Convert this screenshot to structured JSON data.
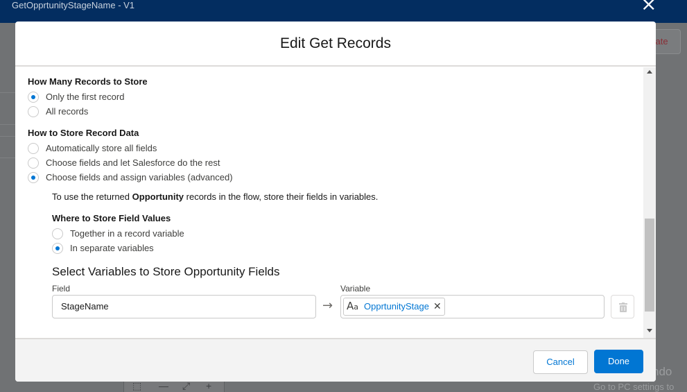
{
  "app": {
    "title": "GetOpprtunityStageName - V1",
    "background_button": "vate"
  },
  "watermark": {
    "line1": "Activate Windo",
    "line2": "Go to PC settings to"
  },
  "modal": {
    "title": "Edit Get Records",
    "how_many": {
      "label": "How Many Records to Store",
      "options": [
        {
          "label": "Only the first record",
          "checked": true
        },
        {
          "label": "All records",
          "checked": false
        }
      ]
    },
    "how_to_store": {
      "label": "How to Store Record Data",
      "options": [
        {
          "label": "Automatically store all fields",
          "checked": false
        },
        {
          "label": "Choose fields and let Salesforce do the rest",
          "checked": false
        },
        {
          "label": "Choose fields and assign variables (advanced)",
          "checked": true
        }
      ]
    },
    "info": {
      "before": "To use the returned ",
      "bold": "Opportunity",
      "after": " records in the flow, store their fields in variables."
    },
    "where_to_store": {
      "label": "Where to Store Field Values",
      "options": [
        {
          "label": "Together in a record variable",
          "checked": false
        },
        {
          "label": "In separate variables",
          "checked": true
        }
      ]
    },
    "select_heading": "Select Variables to Store Opportunity Fields",
    "mapping": {
      "field_label": "Field",
      "variable_label": "Variable",
      "field_value": "StageName",
      "variable_value": "OpprtunityStage",
      "variable_icon": "text-variable-icon"
    },
    "footer": {
      "cancel": "Cancel",
      "done": "Done"
    },
    "colors": {
      "brand": "#0176d3",
      "header_bg": "#032d60"
    }
  }
}
